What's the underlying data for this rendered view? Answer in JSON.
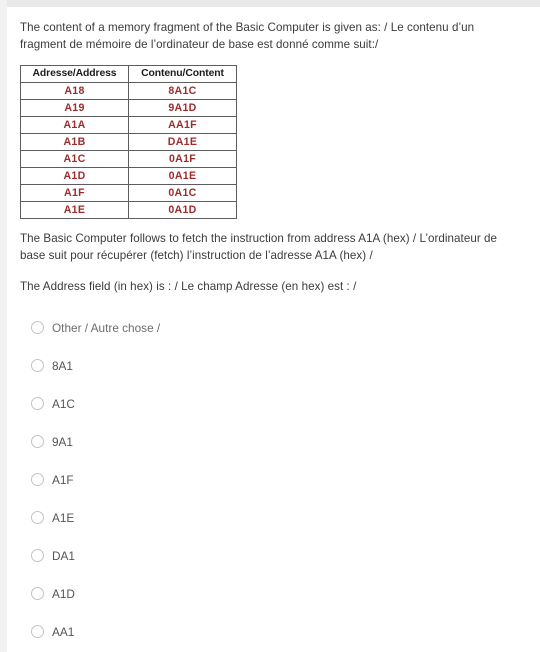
{
  "intro": {
    "text": "The content of a memory fragment of the Basic Computer is given as: / Le contenu d’un fragment de mémoire de l’ordinateur de base est donné comme suit:/"
  },
  "memory_table": {
    "headers": [
      "Adresse/Address",
      "Contenu/Content"
    ],
    "rows": [
      [
        "A18",
        "8A1C"
      ],
      [
        "A19",
        "9A1D"
      ],
      [
        "A1A",
        "AA1F"
      ],
      [
        "A1B",
        "DA1E"
      ],
      [
        "A1C",
        "0A1F"
      ],
      [
        "A1D",
        "0A1E"
      ],
      [
        "A1F",
        "0A1C"
      ],
      [
        "A1E",
        "0A1D"
      ]
    ],
    "value_color": "#9b2d2d",
    "header_color": "#1c1c1c",
    "border_color": "#5d5d5d"
  },
  "fetch": {
    "text": "The Basic Computer follows to fetch the instruction from address A1A (hex) / L’ordinateur de base suit pour récupérer (fetch) l’instruction de l’adresse A1A (hex) /"
  },
  "question": {
    "text": "The Address field (in hex) is : / Le champ Adresse (en hex) est : /"
  },
  "options": [
    {
      "label": "Other / Autre chose /",
      "selected": false
    },
    {
      "label": "8A1",
      "selected": false
    },
    {
      "label": "A1C",
      "selected": false
    },
    {
      "label": "9A1",
      "selected": false
    },
    {
      "label": "A1F",
      "selected": false
    },
    {
      "label": "A1E",
      "selected": false
    },
    {
      "label": "DA1",
      "selected": false
    },
    {
      "label": "A1D",
      "selected": false
    },
    {
      "label": "AA1",
      "selected": false
    }
  ]
}
